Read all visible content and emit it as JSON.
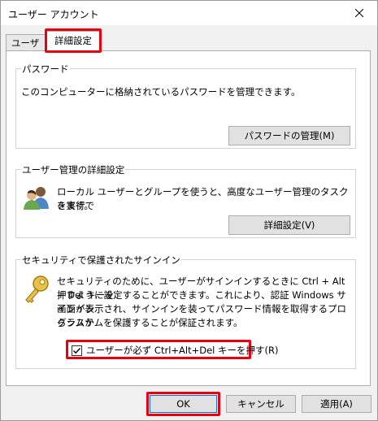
{
  "window": {
    "title": "ユーザー アカウント"
  },
  "tabs": {
    "user": "ユーザー",
    "advanced": "詳細設定"
  },
  "password": {
    "group_label": "パスワード",
    "description": "このコンピューターに格納されているパスワードを管理できます。",
    "button": "パスワードの管理(M)"
  },
  "user_management": {
    "group_label": "ユーザー管理の詳細設定",
    "description_line1": "ローカル ユーザーとグループを使うと、高度なユーザー管理のタスクを実行で",
    "description_line2": "きます。",
    "button": "詳細設定(V)"
  },
  "secure_signin": {
    "group_label": "セキュリティで保護されたサインイン",
    "description_line1": "セキュリティのために、ユーザーがサインインするときに Ctrl + Alt + Del キーを",
    "description_line2": "押すように設定することができます。これにより、認証 Windows サインイン",
    "description_line3": "画面が表示され、サインインを装ってパスワード情報を取得するプログラムか",
    "description_line4": "らシステムを保護することが保証されます。",
    "checkbox_label": "ユーザーが必ず Ctrl+Alt+Del キーを押す(R)",
    "checkbox_checked": true
  },
  "footer": {
    "ok": "OK",
    "cancel": "キャンセル",
    "apply": "適用(A)"
  },
  "colors": {
    "highlight": "#e8000f",
    "button_face": "#e1e1e1",
    "panel": "#ffffff"
  }
}
